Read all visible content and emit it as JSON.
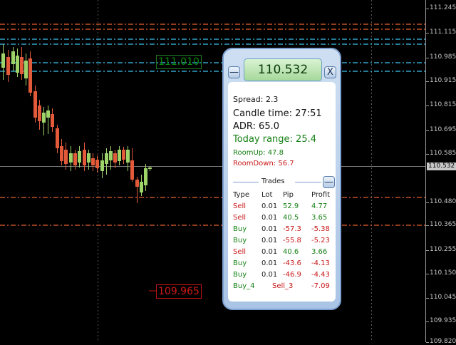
{
  "price_axis": {
    "ticks": [
      "111.245",
      "111.115",
      "110.985",
      "110.915",
      "110.815",
      "110.695",
      "110.585",
      "110.480",
      "110.365",
      "110.255",
      "110.150",
      "110.045",
      "109.935",
      "109.820"
    ],
    "current_price": "110.532"
  },
  "levels": {
    "upper_label": "111.010",
    "lower_label": "109.965"
  },
  "colors": {
    "background": "#000000",
    "bull_candle": "#9ed36a",
    "bear_candle": "#e35a3a",
    "upper_lines": "#3fc3f0",
    "lower_lines": "#e8602c",
    "panel_border": "#7da1d2"
  },
  "panel": {
    "price": "110.532",
    "minimize_icon": "minus-icon",
    "minimize_label": "—",
    "close_label": "X",
    "spread": "Spread: 2.3",
    "candle_time": "Candle time: 27:51",
    "adr": "ADR: 65.0",
    "today_range": "Today range: 25.4",
    "room_up": "RoomUp: 47.8",
    "room_down": "RoomDown: 56.7",
    "trades_title": "Trades",
    "trades_toggle_label": "—",
    "columns": [
      "Type",
      "Lot",
      "Pip",
      "Profit"
    ],
    "trades": [
      {
        "type": "Sell",
        "lot": "0.01",
        "pip": "52.9",
        "profit": "4.77"
      },
      {
        "type": "Sell",
        "lot": "0.01",
        "pip": "40.5",
        "profit": "3.65"
      },
      {
        "type": "Buy",
        "lot": "0.01",
        "pip": "-57.3",
        "profit": "-5.38"
      },
      {
        "type": "Buy",
        "lot": "0.01",
        "pip": "-55.8",
        "profit": "-5.23"
      },
      {
        "type": "Sell",
        "lot": "0.01",
        "pip": "40.6",
        "profit": "3.66"
      },
      {
        "type": "Buy",
        "lot": "0.01",
        "pip": "-43.6",
        "profit": "-4.13"
      },
      {
        "type": "Buy",
        "lot": "0.01",
        "pip": "-46.9",
        "profit": "-4.43"
      }
    ],
    "totals": {
      "buy": "Buy_4",
      "sell": "Sell_3",
      "profit": "-7.09"
    }
  }
}
